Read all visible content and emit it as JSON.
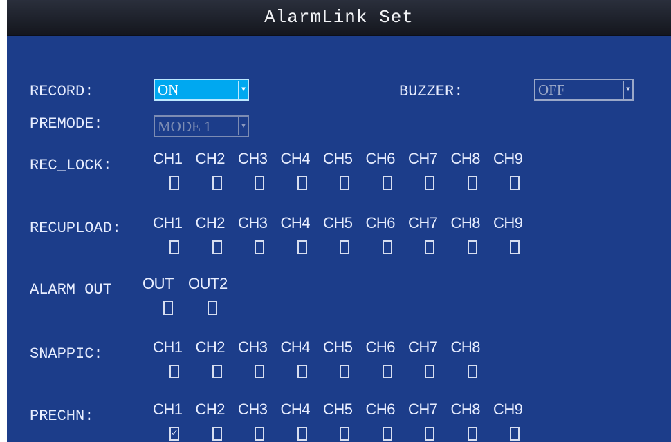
{
  "title": "AlarmLink Set",
  "record": {
    "label": "RECORD:",
    "value": "ON"
  },
  "buzzer": {
    "label": "BUZZER:",
    "value": "OFF"
  },
  "premode": {
    "label": "PREMODE:",
    "value": "MODE 1"
  },
  "rec_lock": {
    "label": "REC_LOCK:",
    "channels": [
      "CH1",
      "CH2",
      "CH3",
      "CH4",
      "CH5",
      "CH6",
      "CH7",
      "CH8",
      "CH9"
    ],
    "checked": [
      false,
      false,
      false,
      false,
      false,
      false,
      false,
      false,
      false
    ]
  },
  "recupload": {
    "label": "RECUPLOAD:",
    "channels": [
      "CH1",
      "CH2",
      "CH3",
      "CH4",
      "CH5",
      "CH6",
      "CH7",
      "CH8",
      "CH9"
    ],
    "checked": [
      false,
      false,
      false,
      false,
      false,
      false,
      false,
      false,
      false
    ]
  },
  "alarm_out": {
    "label": "ALARM OUT",
    "channels": [
      "OUT",
      "OUT2"
    ],
    "checked": [
      false,
      false
    ]
  },
  "snappic": {
    "label": "SNAPPIC:",
    "channels": [
      "CH1",
      "CH2",
      "CH3",
      "CH4",
      "CH5",
      "CH6",
      "CH7",
      "CH8"
    ],
    "checked": [
      false,
      false,
      false,
      false,
      false,
      false,
      false,
      false
    ]
  },
  "prechn": {
    "label": "PRECHN:",
    "channels": [
      "CH1",
      "CH2",
      "CH3",
      "CH4",
      "CH5",
      "CH6",
      "CH7",
      "CH8",
      "CH9"
    ],
    "checked": [
      true,
      false,
      false,
      false,
      false,
      false,
      false,
      false,
      false
    ]
  },
  "check_mark": "✓",
  "colors": {
    "background": "#1c3d8a",
    "active": "#00a8f0",
    "titlebar": "#1a1d26"
  }
}
